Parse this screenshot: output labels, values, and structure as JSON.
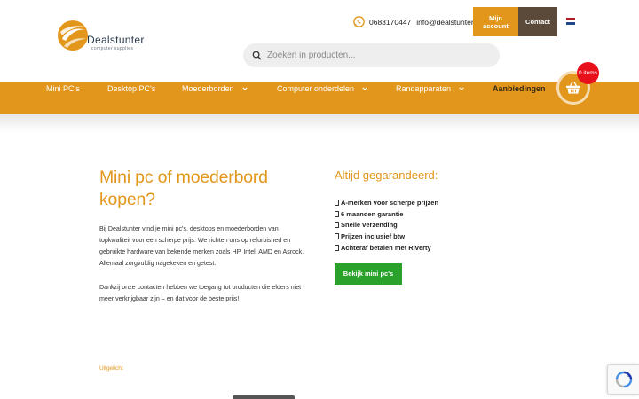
{
  "header": {
    "logo_text": "Dealstunter",
    "logo_sub": "computer supplies",
    "phone": "0683170447",
    "email": "info@dealstunter.nl",
    "account_label_1": "Mijn",
    "account_label_2": "account",
    "contact_label": "Contact",
    "search_placeholder": "Zoeken in producten..."
  },
  "nav": {
    "items": [
      {
        "label": "Mini PC's"
      },
      {
        "label": "Desktop PC's"
      },
      {
        "label": "Moederborden"
      },
      {
        "label": "Computer onderdelen"
      },
      {
        "label": "Randapparaten"
      },
      {
        "label": "Aanbiedingen"
      }
    ],
    "cart_badge": "0 items"
  },
  "intro": {
    "title": "Mini pc of moederbord kopen?",
    "paragraph_1": "Bij Dealstunter vind je mini pc's, desktops en moederborden van topkwaliteit voor een scherpe prijs. We richten ons op refurbished en gebruikte hardware van bekende merken zoals HP, Intel, AMD en Asrock. Allemaal zorgvuldig nagekeken en getest.",
    "paragraph_2": "Dankzij onze contacten hebben we toegang tot producten die elders niet meer verkrijgbaar zijn – en dat voor de beste prijs!"
  },
  "guarantee": {
    "title": "Altijd gegarandeerd:",
    "items": [
      "A-merken voor scherpe prijzen",
      "6 maanden garantie",
      "Snelle verzending",
      "Prijzen inclusief btw",
      "Achteraf betalen met Riverty"
    ],
    "cta_label": "Bekijk mini pc's"
  },
  "featured": {
    "label": "Uitgelicht"
  },
  "colors": {
    "accent": "#e2961b",
    "dark_brown": "#5b4a3a",
    "green": "#2aa12a",
    "badge_red": "#e8101a"
  }
}
